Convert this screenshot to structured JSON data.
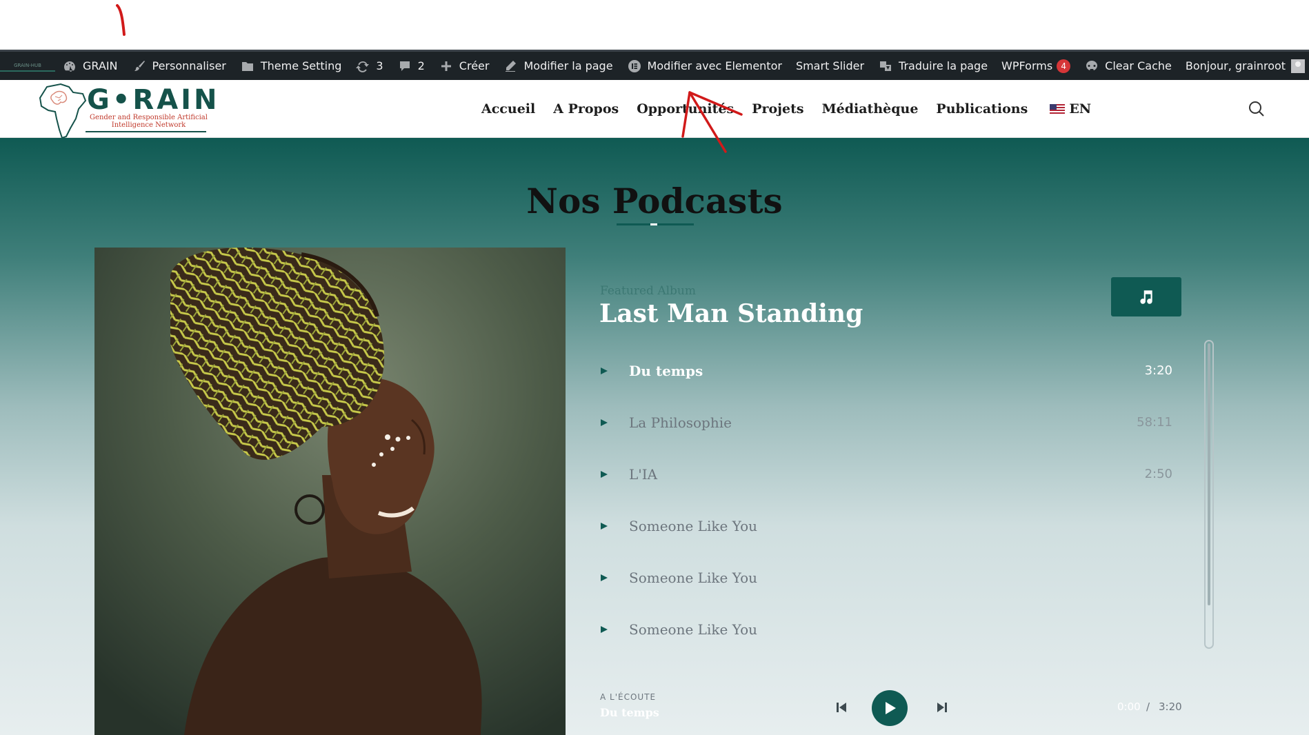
{
  "admin_bar": {
    "site_logo_text": "GRAIN-HUB",
    "site_name": "GRAIN",
    "customize": "Personnaliser",
    "theme_setting": "Theme Setting",
    "updates_count": "3",
    "comments_count": "2",
    "new": "Créer",
    "edit_page": "Modifier la page",
    "edit_elementor": "Modifier avec Elementor",
    "smart_slider": "Smart Slider",
    "translate": "Traduire la page",
    "wpforms": "WPForms",
    "wpforms_badge": "4",
    "clear_cache": "Clear Cache",
    "greeting": "Bonjour, grainroot"
  },
  "header": {
    "logo_title": "G•RAIN",
    "logo_subtitle": "Gender and Responsible Artificial Intelligence Network",
    "nav": [
      "Accueil",
      "A Propos",
      "Opportunités",
      "Projets",
      "Médiathèque",
      "Publications"
    ],
    "language": "EN"
  },
  "hero": {
    "title": "Nos Podcasts"
  },
  "player": {
    "featured_label": "Featured Album",
    "album_title": "Last Man Standing",
    "tracks": [
      {
        "title": "Du temps",
        "duration": "3:20"
      },
      {
        "title": "La Philosophie",
        "duration": "58:11"
      },
      {
        "title": "L'IA",
        "duration": "2:50"
      },
      {
        "title": "Someone Like You",
        "duration": ""
      },
      {
        "title": "Someone Like You",
        "duration": ""
      },
      {
        "title": "Someone Like You",
        "duration": ""
      }
    ],
    "now_playing_label": "A L'ÉCOUTE",
    "now_playing_title": "Du temps",
    "current_time": "0:00",
    "time_separator": "/",
    "total_time": "3:20"
  },
  "colors": {
    "accent": "#0f5a53",
    "admin_bar_bg": "#1d2327",
    "annotation_red": "#d11a1a",
    "badge_red": "#d63638"
  },
  "icons": [
    "dashboard-icon",
    "brush-icon",
    "folder-icon",
    "update-icon",
    "comment-icon",
    "plus-icon",
    "pencil-icon",
    "elementor-icon",
    "translate-icon",
    "cache-icon",
    "avatar-icon",
    "search-icon",
    "music-note-icon",
    "play-icon",
    "skip-previous-icon",
    "skip-next-icon"
  ]
}
